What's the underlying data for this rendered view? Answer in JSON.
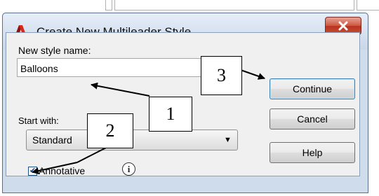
{
  "dialog": {
    "title": "Create New Multileader Style",
    "close_icon": "close-x-icon",
    "app_icon": "autocad-icon"
  },
  "form": {
    "name_label": "New style name:",
    "name_value": "Balloons",
    "start_label": "Start with:",
    "start_value": "Standard",
    "annotative_label": "Annotative",
    "annotative_checked": true,
    "info_icon": "info-icon"
  },
  "buttons": {
    "continue": "Continue",
    "cancel": "Cancel",
    "help": "Help"
  },
  "callouts": {
    "one": "1",
    "two": "2",
    "three": "3"
  },
  "colors": {
    "title_bar": "#dbe6f4",
    "close_button": "#c9503a",
    "client_bg": "#f0f0f0",
    "default_button_border": "#3c7fb1"
  }
}
